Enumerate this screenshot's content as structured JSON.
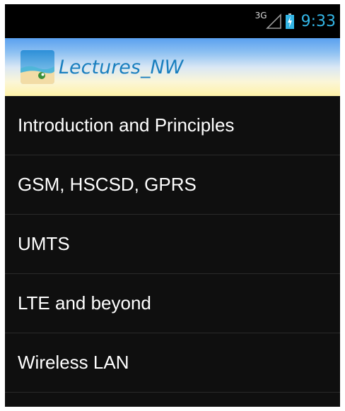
{
  "status_bar": {
    "network_type": "3G",
    "time": "9:33",
    "icons": [
      "signal-icon",
      "battery-charging-icon"
    ],
    "accent_color": "#33b5e5"
  },
  "action_bar": {
    "title": "Lectures_NW",
    "icon": "beach-app-icon",
    "title_color": "#1a7fbf"
  },
  "lectures": [
    {
      "label": "Introduction and Principles"
    },
    {
      "label": "GSM, HSCSD, GPRS"
    },
    {
      "label": "UMTS"
    },
    {
      "label": "LTE and beyond"
    },
    {
      "label": "Wireless LAN"
    }
  ]
}
